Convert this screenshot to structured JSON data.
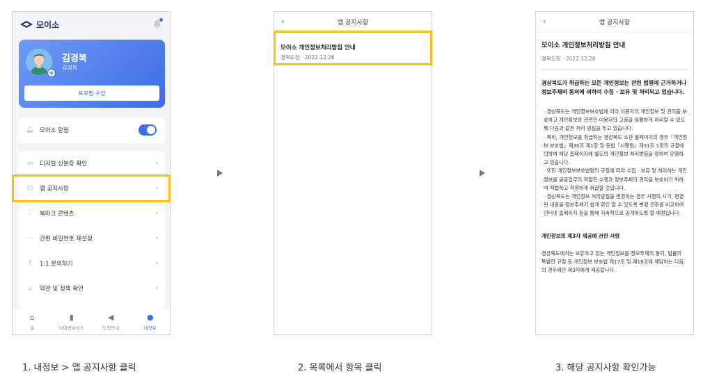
{
  "screen1": {
    "logo_text": "모이소",
    "profile": {
      "name": "김경북",
      "sub": "김경북",
      "edit_label": "프로필 수정"
    },
    "alarm_label": "모이소 알림",
    "alarm_on": true,
    "menu": [
      {
        "icon": "id-card-icon",
        "label": "디지털 신분증 확인"
      },
      {
        "icon": "document-icon",
        "label": "앱 공지사항"
      },
      {
        "icon": "heart-icon",
        "label": "북마크 콘텐츠"
      },
      {
        "icon": "key-icon",
        "label": "간편 비밀번호 재설정"
      },
      {
        "icon": "question-icon",
        "label": "1:1 문의하기"
      },
      {
        "icon": "policy-icon",
        "label": "약관 및 정책 확인"
      }
    ],
    "nav": [
      {
        "icon": "home-icon",
        "label": "홈"
      },
      {
        "icon": "phone-icon",
        "label": "비대면서비스"
      },
      {
        "icon": "megaphone-icon",
        "label": "도정안내"
      },
      {
        "icon": "person-icon",
        "label": "내정보"
      }
    ]
  },
  "screen2": {
    "header_title": "앱 공지사항",
    "item_title": "모이소 개인정보처리방침 안내",
    "item_meta": "경북도청 · 2022.12.26"
  },
  "screen3": {
    "header_title": "앱 공지사항",
    "title": "모이소 개인정보처리방침 안내",
    "meta": "경북도청 · 2022.12.26",
    "lead": "경상북도가 취급하는 모든 개인정보는 관련 법령에 근거하거나 정보주체의 동의에 의하여 수집 · 보유 및 처리되고 있습니다.",
    "bullets": [
      "· 경상북도는 개인정보보호법에 따라 이용자의 개인정보 및 권익을 보호하고 개인정보와 관련한 이용자의 고충을 원활하게 처리할 수 있도록 다음과 같은 처리 방침을 두고 있습니다.",
      "· 특히, 개인정보를 취급하는 경상북도 소관 홈페이지의 경우『개인정보 보호법』제30조 제1항 및 동법『시행령』제31조 1항의 규정에 의하여 해당 홈페이지에 별도의 개인정보 처리방침을 정하여 운영하고 있습니다.",
      "· 또한 개인정보보호법령의 규정에 따라 수집 · 보유 및 처리하는 개인정보를 공공업무의 적절한 수행과 정보주체의 권익을 보호하기 위하여 적법하고 적정하게 취급할 것입니다.",
      "· 경상북도는 개인정보 처리방침을 변경하는 경우 시행의 시기, 변경된 내용을 정보주체가 쉽게 확인 할 수 있도록 변경 전후를 비교하여 인터넷 홈페이지 등을 통해 지속적으로 공개하도록 할 예정입니다."
    ],
    "section_title": "개인정보의 제3자 제공에 관한 사항",
    "section_body": "경상북도에서는 보유하고 있는 개인정보를 정보주체의 동의, 법률의 특별한 규정 등 개인정보 보호법 제17조 및 제18조에 해당하는 다음의 경우에만 제3자에게 제공합니다."
  },
  "captions": [
    "1. 내정보 > 앱 공지사항 클릭",
    "2. 목록에서 항목 클릭",
    "3. 해당 공지사항 확인가능"
  ],
  "colors": {
    "accent": "#3e6de6",
    "highlight": "#f8c21a"
  }
}
